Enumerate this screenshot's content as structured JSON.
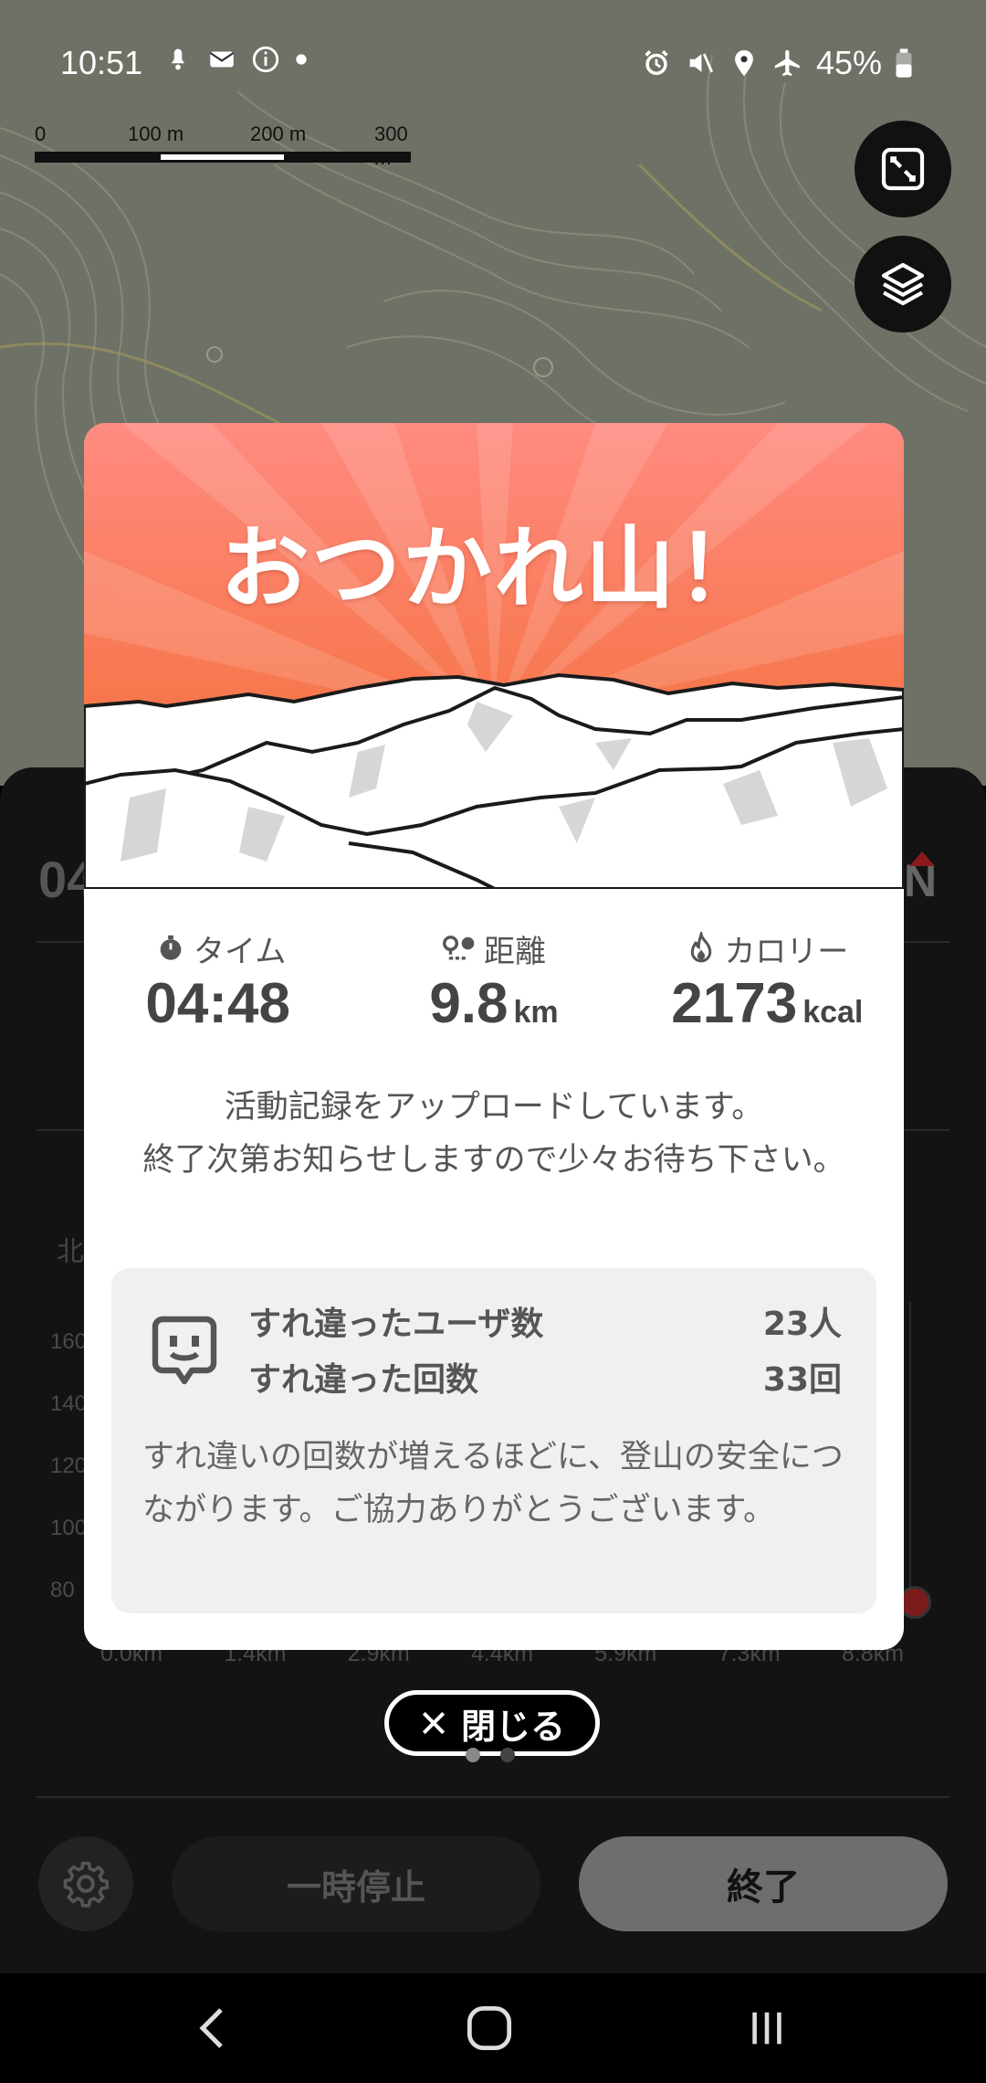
{
  "status": {
    "time": "10:51",
    "left_icons": [
      "notification-icon",
      "mail-icon",
      "info-icon",
      "dot-icon"
    ],
    "right_icons": [
      "alarm-icon",
      "mute-icon",
      "location-icon",
      "airplane-icon"
    ],
    "battery": "45%"
  },
  "scale": {
    "labels": [
      "0",
      "100 m",
      "200 m",
      "300 m"
    ]
  },
  "map_buttons": [
    "fit-screen-icon",
    "layers-icon"
  ],
  "panel": {
    "time_partial": "04",
    "north_partial": "N",
    "chart_label_partial": "北",
    "y_labels": [
      "160",
      "140",
      "120",
      "100",
      "80"
    ],
    "x_labels": [
      "0.0km",
      "1.4km",
      "2.9km",
      "4.4km",
      "5.9km",
      "7.3km",
      "8.8km"
    ],
    "pause_label": "一時停止",
    "end_label": "終了"
  },
  "modal": {
    "title": "おつかれ山！",
    "stats": [
      {
        "label": "タイム",
        "value": "04:48",
        "unit": ""
      },
      {
        "label": "距離",
        "value": "9.8",
        "unit": "km"
      },
      {
        "label": "カロリー",
        "value": "2173",
        "unit": "kcal"
      }
    ],
    "message": "活動記録をアップロードしています。\n終了次第お知らせしますので少々お待ち下さい。",
    "encounter": {
      "users_label": "すれ違ったユーザ数",
      "users_value": "23人",
      "count_label": "すれ違った回数",
      "count_value": "33回",
      "note": "すれ違いの回数が増えるほどに、登山の安全につながります。ご協力ありがとうございます。"
    }
  },
  "close_label": "閉じる",
  "colors": {
    "hero_top": "#ff8a80",
    "hero_bottom": "#f06a2c",
    "panel_bg": "#131313"
  }
}
